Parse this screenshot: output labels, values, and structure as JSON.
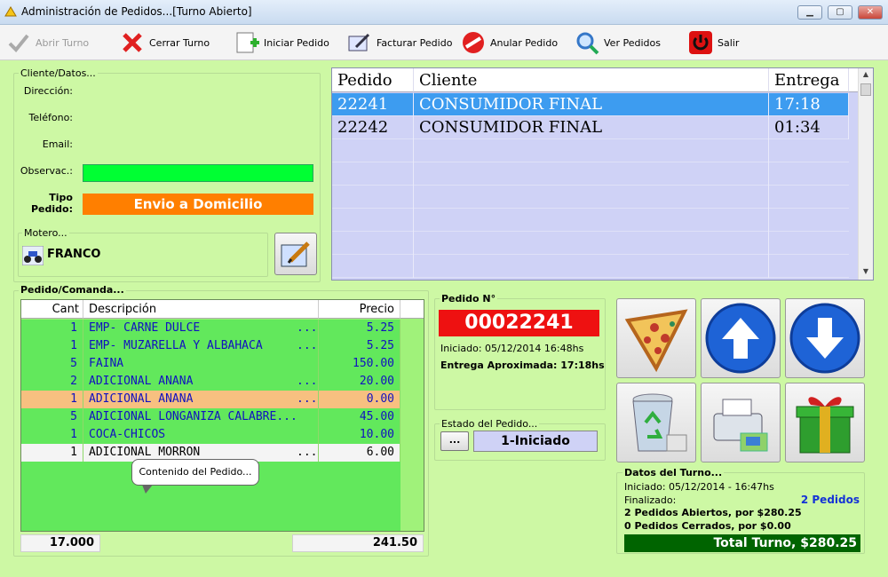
{
  "window": {
    "title": "Administración de Pedidos...[Turno Abierto]"
  },
  "toolbar": {
    "abrir": "Abrir Turno",
    "cerrar": "Cerrar Turno",
    "iniciar": "Iniciar Pedido",
    "facturar": "Facturar Pedido",
    "anular": "Anular Pedido",
    "ver": "Ver Pedidos",
    "salir": "Salir"
  },
  "cliente": {
    "group_label": "Cliente/Datos...",
    "direccion_label": "Dirección:",
    "telefono_label": "Teléfono:",
    "email_label": "Email:",
    "observ_label": "Observac.:",
    "tipo_label_1": "Tipo",
    "tipo_label_2": "Pedido:",
    "tipo_value": "Envio a Domicilio",
    "motero_label": "Motero...",
    "motero_value": "FRANCO"
  },
  "orders": {
    "columns": [
      "Pedido",
      "Cliente",
      "Entrega"
    ],
    "rows": [
      {
        "pedido": "22241",
        "cliente": "CONSUMIDOR FINAL",
        "entrega": "17:18"
      },
      {
        "pedido": "22242",
        "cliente": "CONSUMIDOR FINAL",
        "entrega": "01:34"
      }
    ]
  },
  "comanda": {
    "group_label": "Pedido/Comanda...",
    "columns": [
      "Cant",
      "Descripción",
      "Precio"
    ],
    "rows": [
      {
        "cant": "1",
        "desc": "EMP- CARNE DULCE",
        "dots": "...",
        "precio": "5.25"
      },
      {
        "cant": "1",
        "desc": "EMP- MUZARELLA Y ALBAHACA",
        "dots": "...",
        "precio": "5.25"
      },
      {
        "cant": "5",
        "desc": "FAINA",
        "dots": "",
        "precio": "150.00"
      },
      {
        "cant": "2",
        "desc": "ADICIONAL ANANA",
        "dots": "...",
        "precio": "20.00"
      },
      {
        "cant": "1",
        "desc": "ADICIONAL ANANA",
        "dots": "...",
        "precio": "0.00"
      },
      {
        "cant": "5",
        "desc": "ADICIONAL LONGANIZA CALABRE...",
        "dots": "",
        "precio": "45.00"
      },
      {
        "cant": "1",
        "desc": "COCA-CHICOS",
        "dots": "",
        "precio": "10.00"
      },
      {
        "cant": "1",
        "desc": "ADICIONAL MORRON",
        "dots": "...",
        "precio": "6.00"
      }
    ],
    "tooltip": "Contenido del Pedido...",
    "total_cant": "17.000",
    "total_precio": "241.50"
  },
  "pedido": {
    "label": "Pedido N°",
    "numero": "00022241",
    "iniciado": "Iniciado: 05/12/2014 16:48hs",
    "entrega": "Entrega Aproximada: 17:18hs",
    "estado_label": "Estado del Pedido...",
    "estado_btn": "...",
    "estado_value": "1-Iniciado"
  },
  "turno": {
    "label": "Datos del Turno...",
    "iniciado": "Iniciado: 05/12/2014 - 16:47hs",
    "finalizado": "Finalizado:",
    "pedidos": "2 Pedidos",
    "abiertos": "2 Pedidos Abiertos, por $280.25",
    "cerrados": "0 Pedidos Cerrados, por $0.00",
    "total": "Total Turno, $280.25"
  },
  "colors": {
    "accent_green": "#00ff33",
    "orange": "#ff7f00",
    "red": "#ee1111",
    "dark_green": "#006400"
  }
}
